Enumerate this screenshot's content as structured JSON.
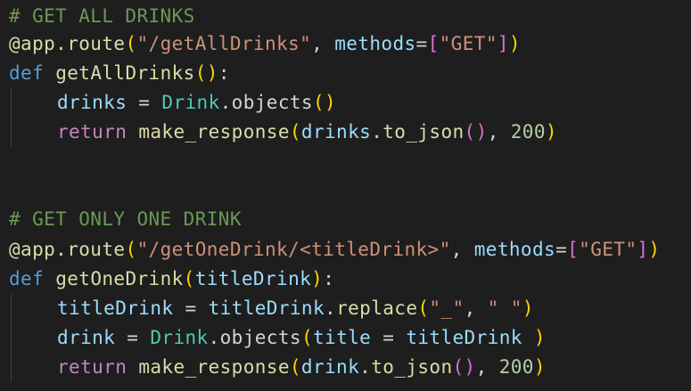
{
  "editor": {
    "colors": {
      "background": "#1e1e1e",
      "comment": "#6a9955",
      "string": "#ce9178",
      "keyword": "#569cd6",
      "control": "#c586c0",
      "function": "#dcdcaa",
      "class": "#4ec9b0",
      "variable": "#9cdcfe",
      "number": "#b5cea8",
      "bracket_gold": "#ffd700",
      "bracket_orchid": "#da70d6",
      "bracket_blue": "#179fff"
    },
    "lines": [
      {
        "indent": false,
        "tokens": [
          {
            "t": "comment",
            "v": "# GET ALL DRINKS"
          }
        ]
      },
      {
        "indent": false,
        "tokens": [
          {
            "t": "decorator",
            "v": "@app.route"
          },
          {
            "t": "bracket1",
            "v": "("
          },
          {
            "t": "string",
            "v": "\"/getAllDrinks\""
          },
          {
            "t": "plain",
            "v": ", "
          },
          {
            "t": "param",
            "v": "methods"
          },
          {
            "t": "plain",
            "v": "="
          },
          {
            "t": "bracket2",
            "v": "["
          },
          {
            "t": "string",
            "v": "\"GET\""
          },
          {
            "t": "bracket2",
            "v": "]"
          },
          {
            "t": "bracket1",
            "v": ")"
          }
        ]
      },
      {
        "indent": false,
        "tokens": [
          {
            "t": "keyword",
            "v": "def"
          },
          {
            "t": "plain",
            "v": " "
          },
          {
            "t": "function",
            "v": "getAllDrinks"
          },
          {
            "t": "bracket1",
            "v": "()"
          },
          {
            "t": "plain",
            "v": ":"
          }
        ]
      },
      {
        "indent": true,
        "tokens": [
          {
            "t": "variable",
            "v": "drinks"
          },
          {
            "t": "plain",
            "v": " = "
          },
          {
            "t": "class",
            "v": "Drink"
          },
          {
            "t": "plain",
            "v": "."
          },
          {
            "t": "plain",
            "v": "objects"
          },
          {
            "t": "bracket1",
            "v": "()"
          }
        ]
      },
      {
        "indent": true,
        "tokens": [
          {
            "t": "control",
            "v": "return"
          },
          {
            "t": "plain",
            "v": " "
          },
          {
            "t": "function",
            "v": "make_response"
          },
          {
            "t": "bracket1",
            "v": "("
          },
          {
            "t": "variable",
            "v": "drinks"
          },
          {
            "t": "plain",
            "v": "."
          },
          {
            "t": "function",
            "v": "to_json"
          },
          {
            "t": "bracket2",
            "v": "()"
          },
          {
            "t": "plain",
            "v": ", "
          },
          {
            "t": "number",
            "v": "200"
          },
          {
            "t": "bracket1",
            "v": ")"
          }
        ]
      },
      {
        "indent": false,
        "tokens": []
      },
      {
        "indent": false,
        "tokens": []
      },
      {
        "indent": false,
        "tokens": [
          {
            "t": "comment",
            "v": "# GET ONLY ONE DRINK"
          }
        ]
      },
      {
        "indent": false,
        "tokens": [
          {
            "t": "decorator",
            "v": "@app.route"
          },
          {
            "t": "bracket1",
            "v": "("
          },
          {
            "t": "string",
            "v": "\"/getOneDrink/<titleDrink>\""
          },
          {
            "t": "plain",
            "v": ", "
          },
          {
            "t": "param",
            "v": "methods"
          },
          {
            "t": "plain",
            "v": "="
          },
          {
            "t": "bracket2",
            "v": "["
          },
          {
            "t": "string",
            "v": "\"GET\""
          },
          {
            "t": "bracket2",
            "v": "]"
          },
          {
            "t": "bracket1",
            "v": ")"
          }
        ]
      },
      {
        "indent": false,
        "tokens": [
          {
            "t": "keyword",
            "v": "def"
          },
          {
            "t": "plain",
            "v": " "
          },
          {
            "t": "function",
            "v": "getOneDrink"
          },
          {
            "t": "bracket1",
            "v": "("
          },
          {
            "t": "param",
            "v": "titleDrink"
          },
          {
            "t": "bracket1",
            "v": ")"
          },
          {
            "t": "plain",
            "v": ":"
          }
        ]
      },
      {
        "indent": true,
        "tokens": [
          {
            "t": "variable",
            "v": "titleDrink"
          },
          {
            "t": "plain",
            "v": " = "
          },
          {
            "t": "variable",
            "v": "titleDrink"
          },
          {
            "t": "plain",
            "v": "."
          },
          {
            "t": "function",
            "v": "replace"
          },
          {
            "t": "bracket1",
            "v": "("
          },
          {
            "t": "string",
            "v": "\"_\""
          },
          {
            "t": "plain",
            "v": ", "
          },
          {
            "t": "string",
            "v": "\" \""
          },
          {
            "t": "bracket1",
            "v": ")"
          }
        ]
      },
      {
        "indent": true,
        "tokens": [
          {
            "t": "variable",
            "v": "drink"
          },
          {
            "t": "plain",
            "v": " = "
          },
          {
            "t": "class",
            "v": "Drink"
          },
          {
            "t": "plain",
            "v": "."
          },
          {
            "t": "plain",
            "v": "objects"
          },
          {
            "t": "bracket1",
            "v": "("
          },
          {
            "t": "param",
            "v": "title"
          },
          {
            "t": "plain",
            "v": " = "
          },
          {
            "t": "variable",
            "v": "titleDrink"
          },
          {
            "t": "plain",
            "v": " "
          },
          {
            "t": "bracket1",
            "v": ")"
          }
        ]
      },
      {
        "indent": true,
        "tokens": [
          {
            "t": "control",
            "v": "return"
          },
          {
            "t": "plain",
            "v": " "
          },
          {
            "t": "function",
            "v": "make_response"
          },
          {
            "t": "bracket1",
            "v": "("
          },
          {
            "t": "variable",
            "v": "drink"
          },
          {
            "t": "plain",
            "v": "."
          },
          {
            "t": "function",
            "v": "to_json"
          },
          {
            "t": "bracket2",
            "v": "()"
          },
          {
            "t": "plain",
            "v": ", "
          },
          {
            "t": "number",
            "v": "200"
          },
          {
            "t": "bracket1",
            "v": ")"
          }
        ]
      }
    ]
  }
}
